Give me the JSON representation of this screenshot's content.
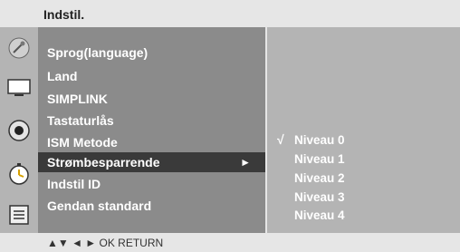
{
  "header": {
    "title": "Indstil."
  },
  "sidebar_icons": [
    {
      "name": "satellite-dish-icon"
    },
    {
      "name": "tv-screen-icon"
    },
    {
      "name": "speaker-icon"
    },
    {
      "name": "clock-icon"
    },
    {
      "name": "settings-list-icon"
    }
  ],
  "menu": {
    "items": [
      "Sprog(language)",
      "Land",
      "SIMPLINK",
      "Tastaturlås",
      "ISM Metode",
      "Strømbesparrende",
      "Indstil ID",
      "Gendan standard"
    ],
    "selected_label": "Strømbesparrende",
    "selected_arrow": "►"
  },
  "submenu": {
    "check": "√",
    "options": [
      "Niveau 0",
      "Niveau 1",
      "Niveau 2",
      "Niveau 3",
      "Niveau 4"
    ]
  },
  "footer": {
    "hints": "▲▼  ◄ ►  OK  RETURN"
  },
  "colors": {
    "menu_bg": "#8b8b8b",
    "submenu_bg": "#b4b4b4",
    "highlight_bg": "#3a3a3a",
    "text": "#ffffff"
  }
}
